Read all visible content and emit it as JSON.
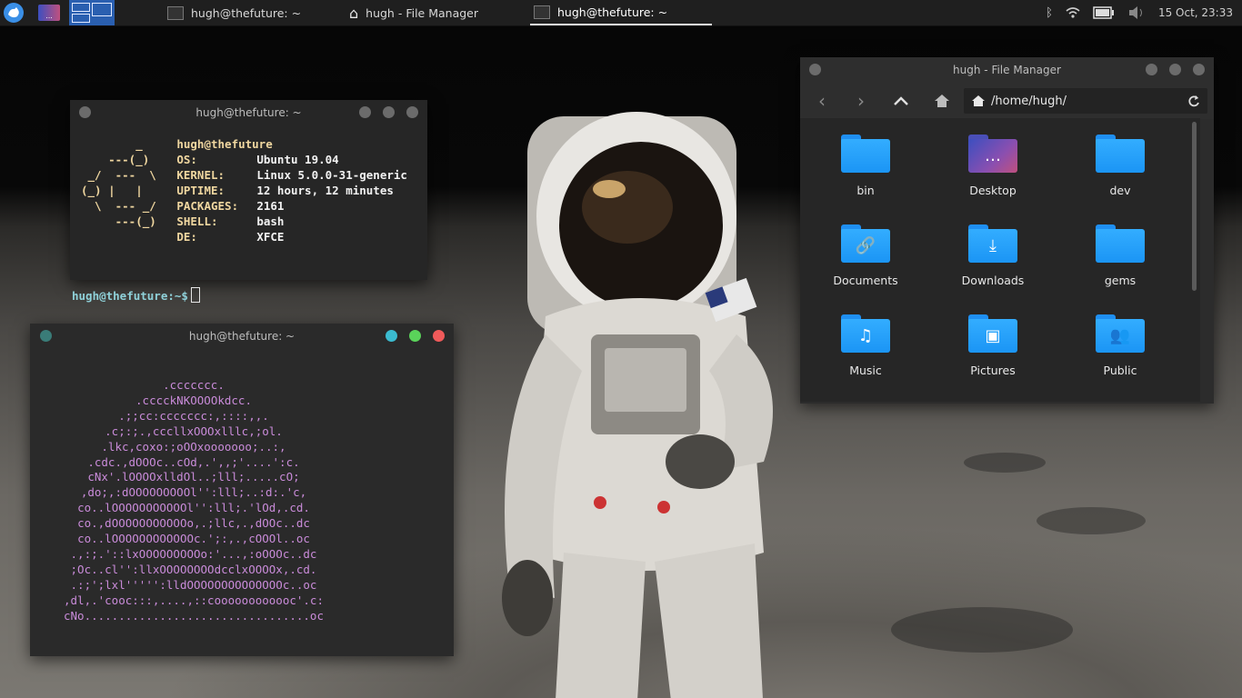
{
  "taskbar": {
    "tasks": [
      {
        "label": "hugh@thefuture: ~",
        "icon": "terminal-icon",
        "active": false
      },
      {
        "label": "hugh - File Manager",
        "icon": "home-icon",
        "active": false
      },
      {
        "label": "hugh@thefuture: ~",
        "icon": "terminal-icon",
        "active": true
      }
    ],
    "clock": "15 Oct, 23:33"
  },
  "terminal1": {
    "title": "hugh@thefuture: ~",
    "logo_lines": [
      "        _   ",
      "    ---(_)  ",
      " _/  ---  \\ ",
      "(_) |   |   ",
      "  \\  --- _/ ",
      "     ---(_) ",
      "            "
    ],
    "user_host": "hugh@thefuture",
    "info": [
      {
        "key": "OS:",
        "value": "Ubuntu 19.04"
      },
      {
        "key": "KERNEL:",
        "value": "Linux 5.0.0-31-generic"
      },
      {
        "key": "UPTIME:",
        "value": "12 hours, 12 minutes"
      },
      {
        "key": "PACKAGES:",
        "value": "2161"
      },
      {
        "key": "SHELL:",
        "value": "bash"
      },
      {
        "key": "DE:",
        "value": "XFCE"
      }
    ],
    "prompt": "hugh@thefuture:~$"
  },
  "terminal2": {
    "title": "hugh@thefuture: ~",
    "art": [
      ".ccccccc.",
      ".cccckNKOOOOkdcc.",
      ".;;cc:ccccccc:,::::,,.",
      ".c;:;.,cccllxOOOxlllc,;ol.",
      ".lkc,coxo:;oOOxooooooo;..:,",
      ".cdc.,dOOOc..cOd,.',,;'....':c.",
      "cNx'.lOOOOxlldOl..;lll;.....cO;",
      ",do;,:dOOOOOOOOOl'':lll;..:d:.'c,",
      "co..lOOOOOOOOOOOl'':lll;.'lOd,.cd.",
      "co.,dOOOOOOOOOOOo,.;llc,.,dOOc..dc",
      "co..lOOOOOOOOOOOOc.';:,.,cOOOl..oc",
      ".,:;.'::lxOOOOOOOOOo:'...,:oOOOc..dc",
      ";Oc..cl'':llxOOOOOOOOdcclxOOOOx,.cd.",
      ".:;';lxl''''':lldOOOOOOOOOOOOOOc..oc",
      ",dl,.'cooc:::,....,::coooooooooooc'.c:",
      "cNo.................................oc"
    ]
  },
  "file_manager": {
    "title": "hugh - File Manager",
    "path": "/home/hugh/",
    "items": [
      {
        "label": "bin",
        "icon": "folder-icon"
      },
      {
        "label": "Desktop",
        "icon": "desktop-folder-icon"
      },
      {
        "label": "dev",
        "icon": "folder-icon"
      },
      {
        "label": "Documents",
        "icon": "documents-folder-icon"
      },
      {
        "label": "Downloads",
        "icon": "downloads-folder-icon"
      },
      {
        "label": "gems",
        "icon": "folder-icon"
      },
      {
        "label": "Music",
        "icon": "music-folder-icon"
      },
      {
        "label": "Pictures",
        "icon": "pictures-folder-icon"
      },
      {
        "label": "Public",
        "icon": "public-folder-icon"
      }
    ]
  },
  "colors": {
    "folder_blue": "#1f9af5",
    "art_purple": "#c98bd9",
    "fetch_key": "#f0d7a0",
    "prompt_cyan": "#8fd1d9",
    "close_red": "#f05a5a",
    "max_green": "#5ad35a",
    "min_cyan": "#3bbbd0"
  }
}
